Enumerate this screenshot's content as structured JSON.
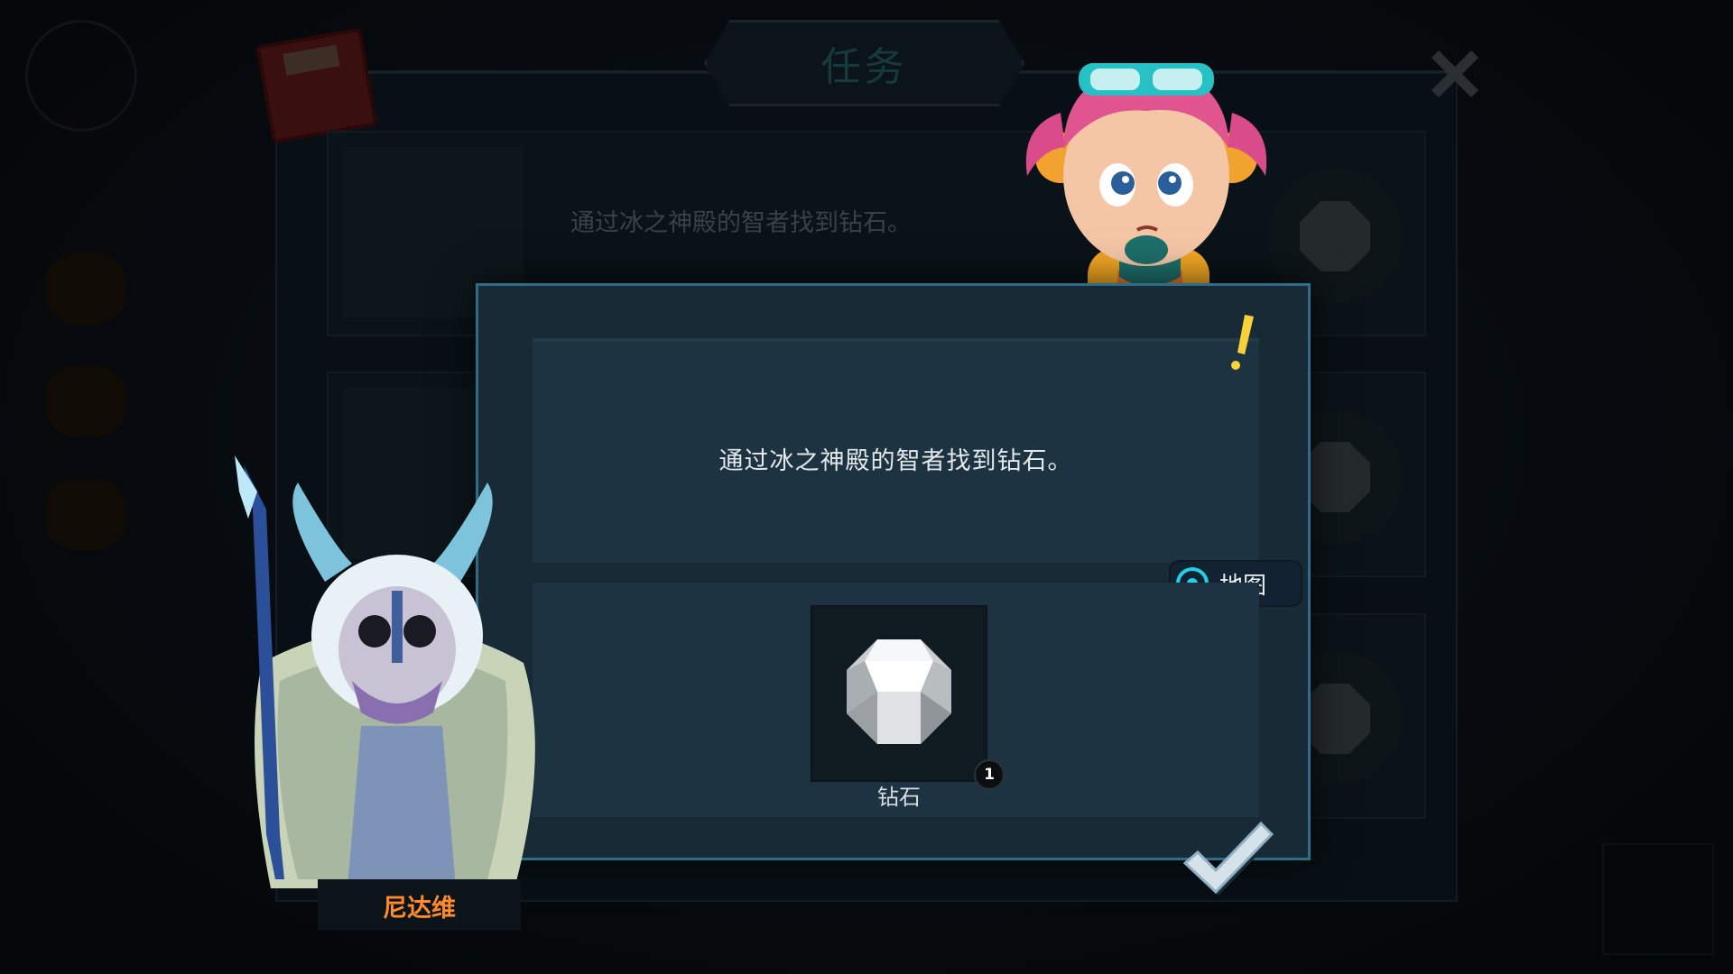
{
  "background": {
    "window_title": "任务",
    "task_rows": [
      {
        "text": "通过冰之神殿的智者找到钻石。"
      },
      {
        "text": ""
      },
      {
        "text": ""
      }
    ]
  },
  "dialog": {
    "description": "通过冰之神殿的智者找到钻石。",
    "map_button_label": "地图",
    "reward": {
      "item_name": "钻石",
      "count": "1",
      "icon": "diamond-icon"
    },
    "confirm_icon": "checkmark-icon"
  },
  "npc": {
    "name": "尼达维",
    "name_color": "#ff8a2a"
  },
  "colors": {
    "dialog_border": "#2f6d86",
    "accent_cyan": "#1fd1e6",
    "exclamation": "#f7d23a"
  }
}
